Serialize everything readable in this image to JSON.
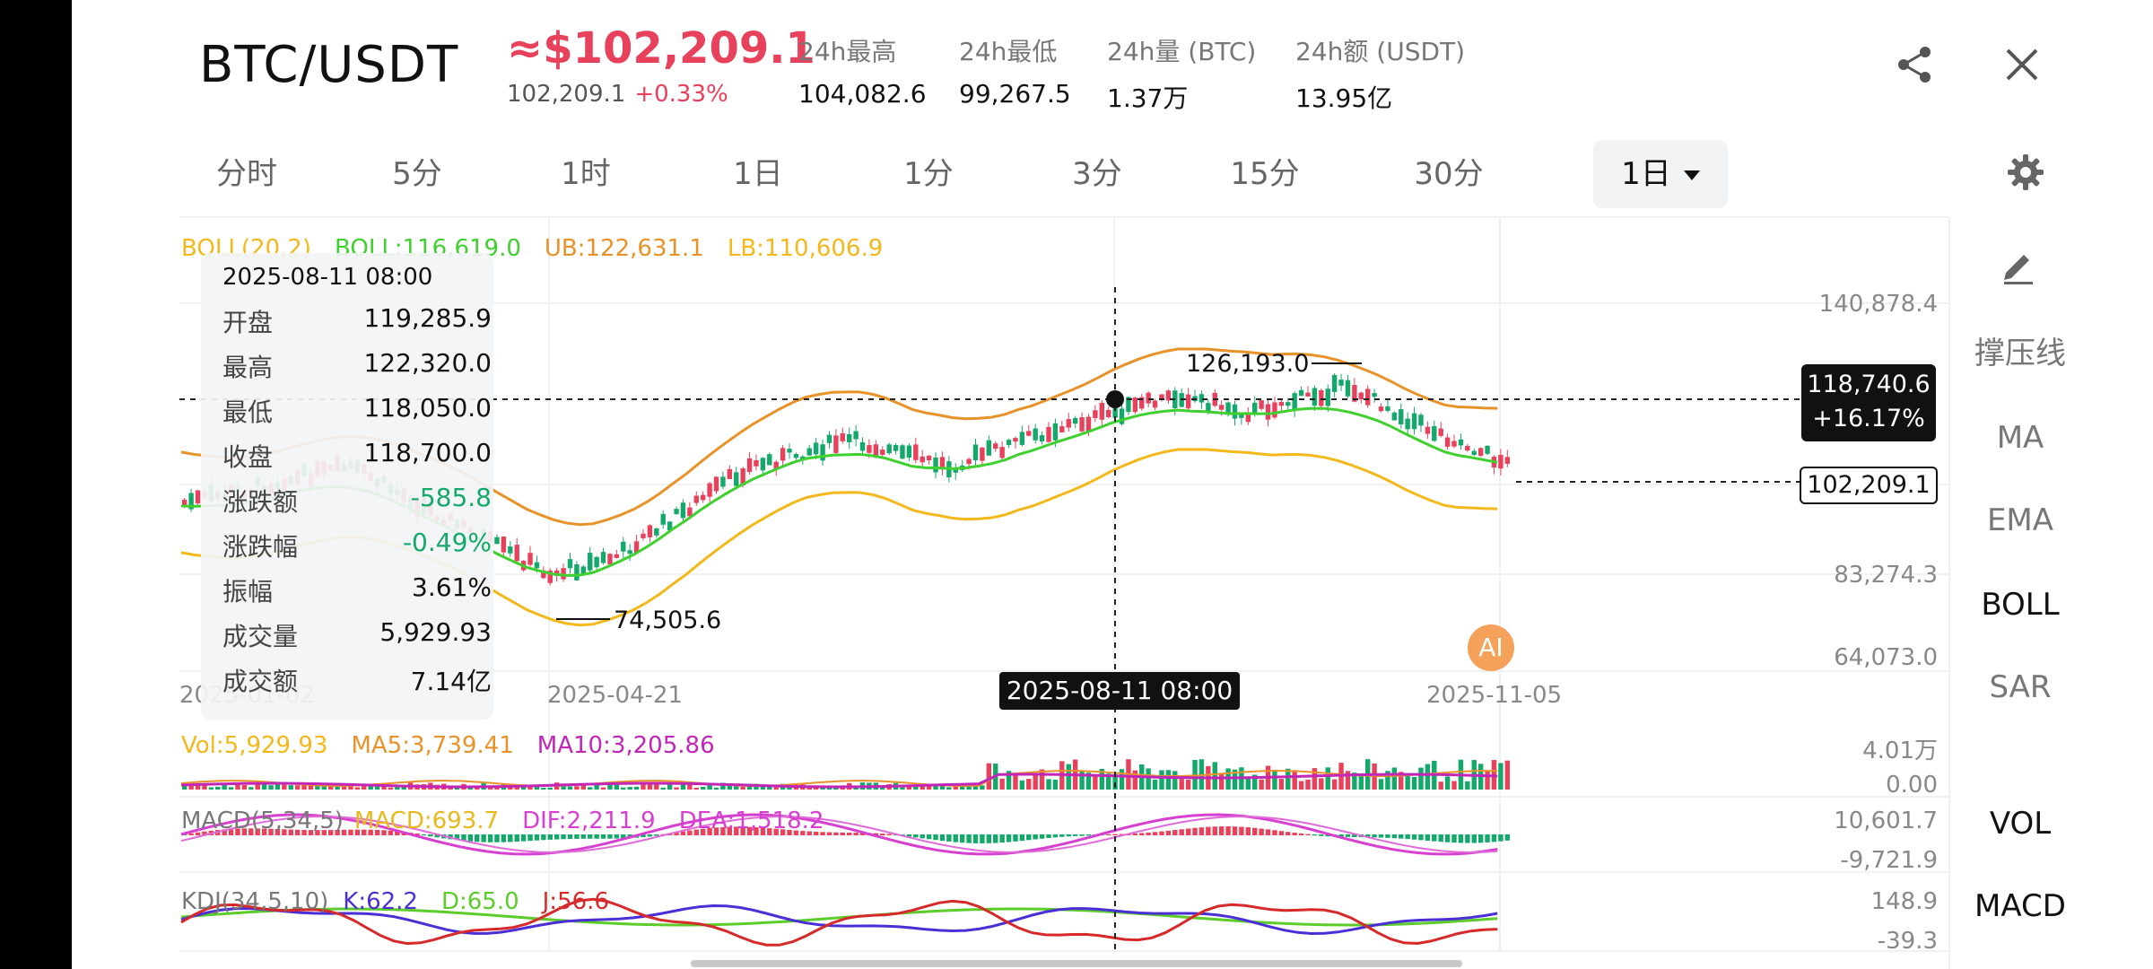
{
  "header": {
    "pair": "BTC/USDT",
    "price": "≈$102,209.1",
    "sub_price": "102,209.1",
    "sub_change": "+0.33%",
    "stats": [
      {
        "label": "24h最高",
        "value": "104,082.6"
      },
      {
        "label": "24h最低",
        "value": "99,267.5"
      },
      {
        "label": "24h量 (BTC)",
        "value": "1.37万"
      },
      {
        "label": "24h额 (USDT)",
        "value": "13.95亿"
      }
    ]
  },
  "tabs": [
    {
      "label": "分时"
    },
    {
      "label": "5分"
    },
    {
      "label": "1时"
    },
    {
      "label": "1日"
    },
    {
      "label": "1分"
    },
    {
      "label": "3分"
    },
    {
      "label": "15分"
    },
    {
      "label": "30分"
    },
    {
      "label": "1日",
      "active": true
    }
  ],
  "boll_legend": {
    "name": "BOLL(20,2)",
    "mid": "BOLL:116,619.0",
    "ub": "UB:122,631.1",
    "lb": "LB:110,606.9"
  },
  "tooltip": {
    "title": "2025-08-11 08:00",
    "rows": [
      {
        "label": "开盘",
        "value": "119,285.9"
      },
      {
        "label": "最高",
        "value": "122,320.0"
      },
      {
        "label": "最低",
        "value": "118,050.0"
      },
      {
        "label": "收盘",
        "value": "118,700.0"
      },
      {
        "label": "涨跌额",
        "value": "-585.8"
      },
      {
        "label": "涨跌幅",
        "value": "-0.49%"
      },
      {
        "label": "振幅",
        "value": "3.61%"
      },
      {
        "label": "成交量",
        "value": "5,929.93"
      },
      {
        "label": "成交额",
        "value": "7.14亿"
      }
    ]
  },
  "price_scale": [
    "140,878.4",
    "83,274.3",
    "64,073.0"
  ],
  "x_labels": [
    "2025-01-02",
    "2025-04-21",
    "2025-11-05"
  ],
  "crosshair": {
    "date": "2025-08-11 08:00",
    "price": "118,740.6",
    "pct": "+16.17%"
  },
  "current_price_tag": "102,209.1",
  "annotations": {
    "high": "126,193.0",
    "low": "74,505.6"
  },
  "ai_label": "AI",
  "vol_legend": {
    "vol": "Vol:5,929.93",
    "ma5": "MA5:3,739.41",
    "ma10": "MA10:3,205.86"
  },
  "vol_scale": [
    "4.01万",
    "0.00"
  ],
  "macd_legend": {
    "name": "MACD(5,34,5)",
    "macd": "MACD:693.7",
    "dif": "DIF:2,211.9",
    "dea": "DEA:1,518.2"
  },
  "macd_scale": [
    "10,601.7",
    "-9,721.9"
  ],
  "kdj_legend": {
    "name": "KDJ(34,5,10)",
    "k": "K:62.2",
    "d": "D:65.0",
    "j": "J:56.6"
  },
  "kdj_scale": [
    "148.9",
    "-39.3"
  ],
  "right_panel": {
    "items": [
      {
        "label": "撑压线"
      },
      {
        "label": "MA"
      },
      {
        "label": "EMA"
      },
      {
        "label": "BOLL",
        "active": true
      },
      {
        "label": "SAR"
      },
      {
        "label": "VOL",
        "active": true
      },
      {
        "label": "MACD",
        "active": true
      }
    ]
  },
  "colors": {
    "up": "#e8415c",
    "down": "#15a86b",
    "boll_mid": "#3fcf2e",
    "boll_ub": "#e8922a",
    "boll_lb": "#f2b81c",
    "macd_dif": "#d63fd0",
    "kdj_k": "#4b2fd6",
    "kdj_d": "#5ccc2a",
    "kdj_j": "#d62a2a"
  }
}
